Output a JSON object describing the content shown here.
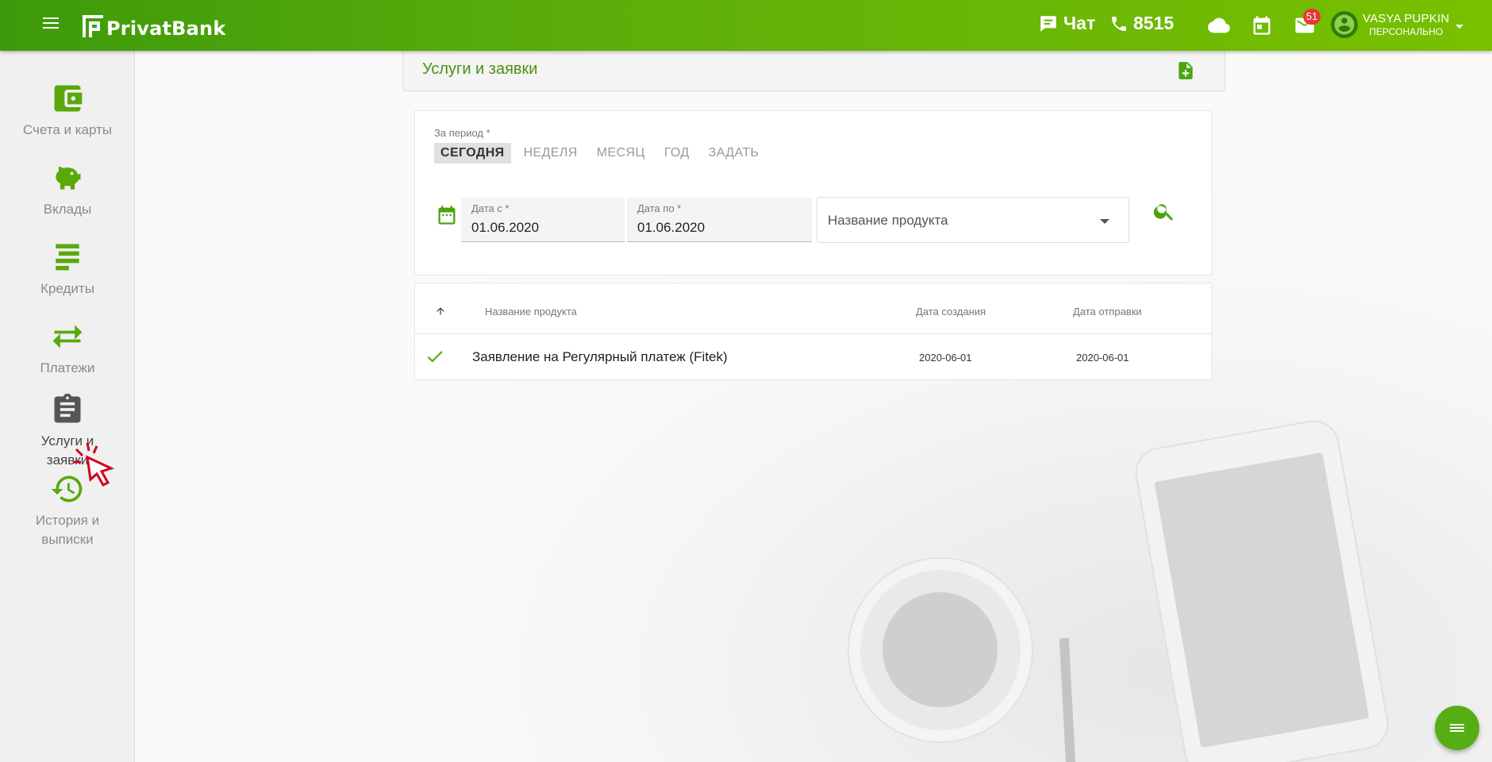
{
  "header": {
    "logo_text": "PrivatBank",
    "chat_label": "Чат",
    "phone_label": "8515",
    "notifications_count": "51",
    "user_name": "VASYA PUPKIN",
    "user_role": "ПЕРСОНАЛЬНО",
    "brand_color": "#5cae0a"
  },
  "sidebar": {
    "items": [
      {
        "label": "Счета и карты",
        "icon": "wallet-icon"
      },
      {
        "label": "Вклады",
        "icon": "piggy-bank-icon"
      },
      {
        "label": "Кредиты",
        "icon": "credit-icon"
      },
      {
        "label": "Платежи",
        "icon": "transfer-arrows-icon"
      },
      {
        "label": "Услуги и заявки",
        "icon": "clipboard-icon",
        "active": true
      },
      {
        "label": "История и выписки",
        "icon": "history-icon"
      }
    ]
  },
  "page": {
    "title": "Услуги и заявки"
  },
  "filter": {
    "period_label": "За период *",
    "periods": [
      "СЕГОДНЯ",
      "НЕДЕЛЯ",
      "МЕСЯЦ",
      "ГОД",
      "ЗАДАТЬ"
    ],
    "selected_period": "СЕГОДНЯ",
    "date_from_label": "Дата с *",
    "date_from_value": "01.06.2020",
    "date_to_label": "Дата по *",
    "date_to_value": "01.06.2020",
    "product_placeholder": "Название продукта"
  },
  "table": {
    "columns": [
      "Название продукта",
      "Дата создания",
      "Дата отправки"
    ],
    "rows": [
      {
        "status": "done",
        "name": "Заявление на Регулярный платеж (Fitek)",
        "created": "2020-06-01",
        "sent": "2020-06-01"
      }
    ]
  }
}
